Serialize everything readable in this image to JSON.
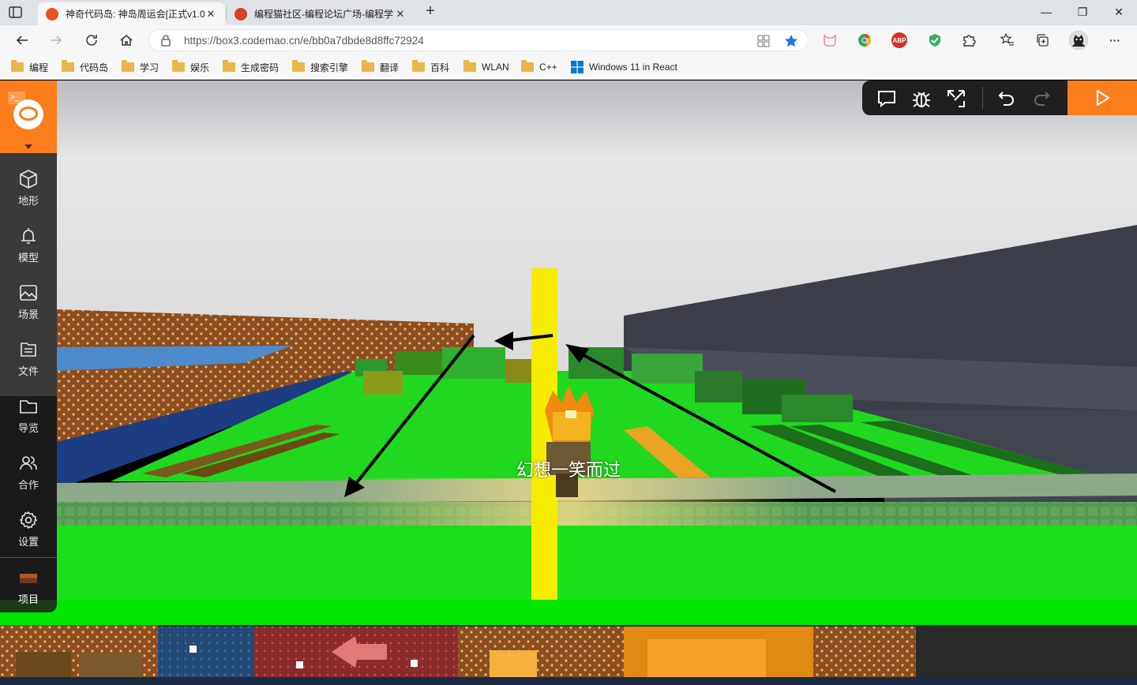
{
  "browser": {
    "tabs": [
      {
        "title": "神奇代码岛: 神岛周运会[正式v1.0",
        "active": true,
        "favicon_color": "#e8531f"
      },
      {
        "title": "编程猫社区-编程论坛广场-编程学",
        "active": false,
        "favicon_color": "#d9402b"
      }
    ],
    "address": {
      "url": "https://box3.codemao.cn/e/bb0a7dbde8d8ffc72924"
    },
    "window_controls": {
      "minimize": "—",
      "maximize": "❐",
      "close": "✕"
    },
    "bookmarks": [
      "编程",
      "代码岛",
      "学习",
      "娱乐",
      "生成密码",
      "搜索引擎",
      "翻译",
      "百科",
      "WLAN",
      "C++",
      "Windows 11 in React"
    ],
    "extensions": {
      "abp_label": "ABP"
    }
  },
  "editor": {
    "sidebar": {
      "items": [
        {
          "label": "地形",
          "icon": "cube-icon"
        },
        {
          "label": "模型",
          "icon": "bell-icon"
        },
        {
          "label": "场景",
          "icon": "image-icon"
        },
        {
          "label": "文件",
          "icon": "file-icon"
        },
        {
          "label": "导览",
          "icon": "folder-icon"
        },
        {
          "label": "合作",
          "icon": "users-icon"
        },
        {
          "label": "设置",
          "icon": "gear-icon"
        }
      ],
      "project_label": "项目"
    },
    "toolbar": {
      "buttons": [
        "comment-icon",
        "bug-icon",
        "expand-icon",
        "undo-icon",
        "redo-icon"
      ],
      "run_icon": "play-icon"
    },
    "accent_color": "#fb7d1c"
  },
  "game": {
    "player_name": "幻想一笑而过"
  }
}
